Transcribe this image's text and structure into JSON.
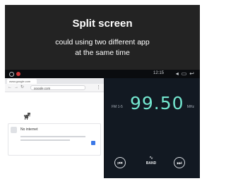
{
  "banner": {
    "title": "Split screen",
    "subtitle_line1": "could using two different app",
    "subtitle_line2": "at the same time"
  },
  "status_bar": {
    "time": "12:15",
    "icons": [
      "volume-icon",
      "battery-icon",
      "back-icon"
    ]
  },
  "browser": {
    "tab_label": "www.google.com",
    "url": "google.com",
    "offline_title": "No internet"
  },
  "radio": {
    "band": "FM 1-5",
    "frequency": "99.50",
    "unit": "MHz",
    "band_button_label": "BAND"
  },
  "colors": {
    "banner_bg": "#232323",
    "frequency_color": "#73e6cf",
    "radio_bg": "#121922"
  }
}
